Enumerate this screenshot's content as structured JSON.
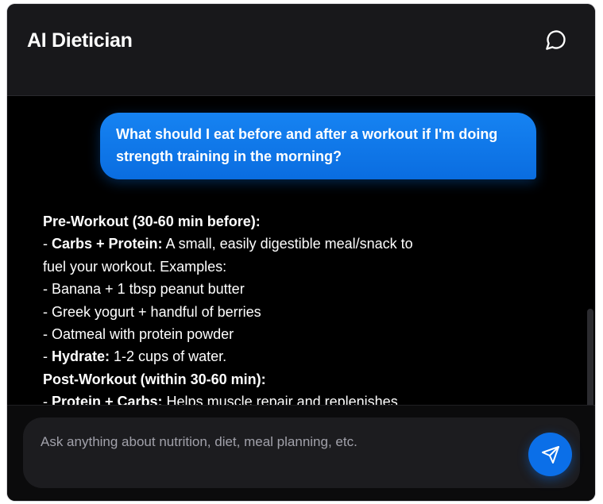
{
  "header": {
    "title": "AI Dietician",
    "chat_icon": "message-circle-icon"
  },
  "messages": {
    "user": "What should I eat before and after a workout if I'm doing strength training in the morning?",
    "assistant": {
      "pre_heading": "Pre-Workout (30-60 min before):",
      "pre_carbs_label": "Carbs + Protein:",
      "pre_carbs_text": " A small, easily digestible meal/snack to",
      "pre_carbs_text2": "fuel your workout. Examples:",
      "example1": "- Banana + 1 tbsp peanut butter",
      "example2": "- Greek yogurt + handful of berries",
      "example3": "- Oatmeal with protein powder",
      "hydrate_label": "Hydrate:",
      "hydrate_text": " 1-2 cups of water.",
      "post_heading": "Post-Workout (within 30-60 min):",
      "post_label": "Protein + Carbs:",
      "post_text": " Helps muscle repair and replenishes"
    }
  },
  "composer": {
    "placeholder": "Ask anything about nutrition, diet, meal planning, etc.",
    "send_icon": "send-icon"
  },
  "colors": {
    "accent": "#0b6fe8",
    "background": "#000000",
    "header": "#18181b"
  }
}
